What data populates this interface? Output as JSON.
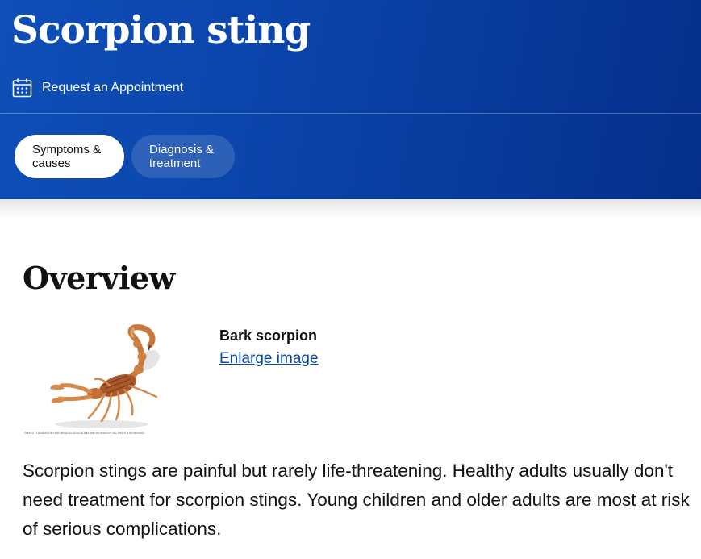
{
  "header": {
    "title": "Scorpion sting",
    "appointment_label": "Request an Appointment",
    "appointment_icon": "calendar-icon",
    "gradient_colors": [
      "#0e4fb8",
      "#062f8c"
    ]
  },
  "tabs": [
    {
      "label_line1": "Symptoms &",
      "label_line2": "causes",
      "active": true
    },
    {
      "label_line1": "Diagnosis &",
      "label_line2": "treatment",
      "active": false
    }
  ],
  "overview": {
    "heading": "Overview",
    "figure": {
      "caption_title": "Bark scorpion",
      "link_text": "Enlarge image",
      "credit": "©MAYO FOUNDATION FOR MEDICAL EDUCATION AND RESEARCH. ALL RIGHTS RESERVED."
    },
    "paragraph": "Scorpion stings are painful but rarely life-threatening. Healthy adults usually don't need treatment for scorpion stings. Young children and older adults are most at risk of serious complications."
  }
}
